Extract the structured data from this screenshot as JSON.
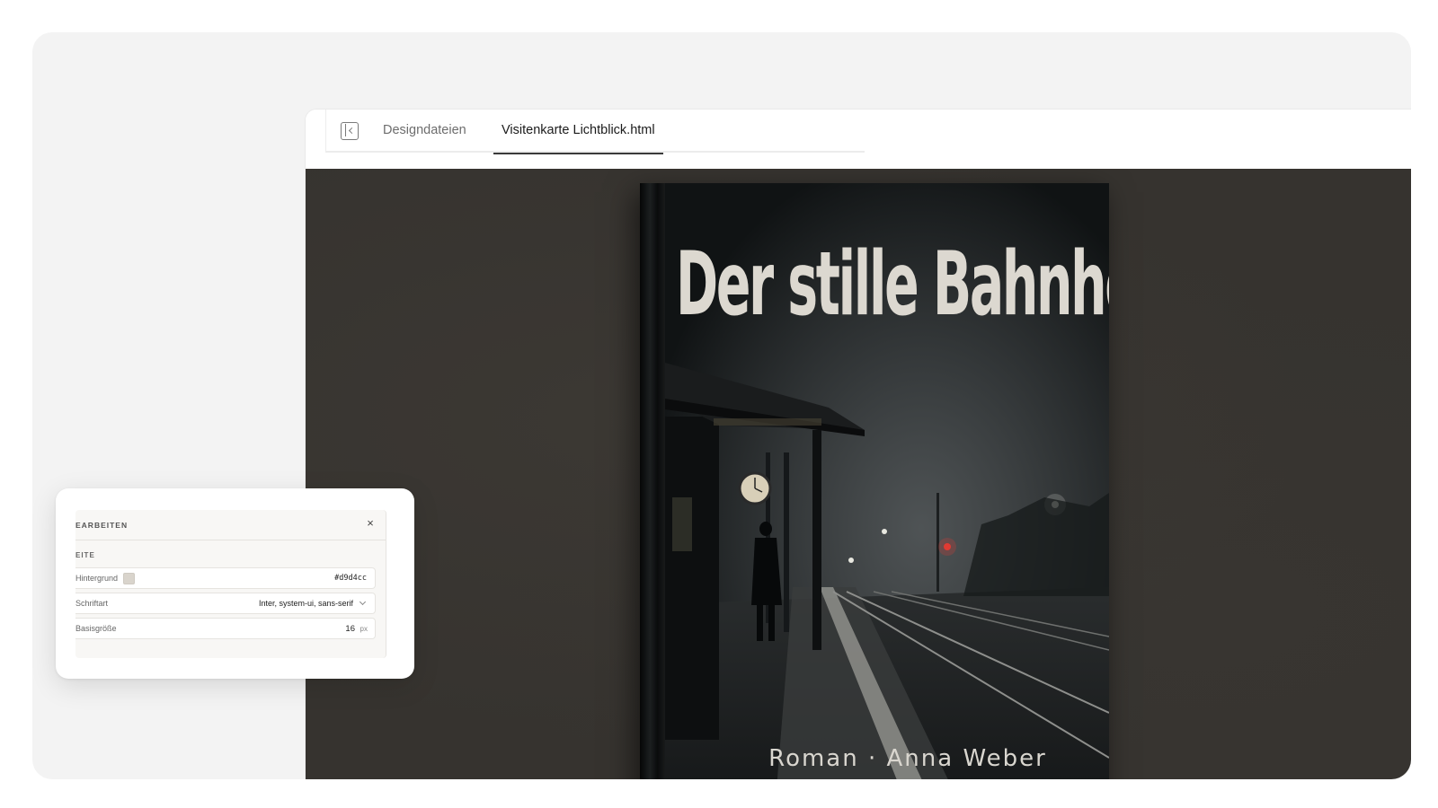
{
  "tabs": {
    "items": [
      {
        "label": "Designdateien",
        "active": false
      },
      {
        "label": "Visitenkarte Lichtblick.html",
        "active": true
      }
    ]
  },
  "icons": {
    "sidebar_toggle": "sidebar-toggle-icon",
    "close": "close-icon",
    "chevron": "chevron-down-icon"
  },
  "book": {
    "title": "Der stille Bahnhof",
    "subtitle": "Roman · Anna Weber"
  },
  "panel": {
    "title": "EARBEITEN",
    "close_glyph": "×",
    "section": "EITE",
    "rows": {
      "background": {
        "label": "Hintergrund",
        "value": "#d9d4cc",
        "swatch": "#d9d4cc"
      },
      "font": {
        "label": "Schriftart",
        "value": "Inter, system-ui, sans-serif"
      },
      "base_size": {
        "label": "Basisgröße",
        "value": "16",
        "unit": "px"
      }
    }
  },
  "colors": {
    "stage_bg": "#f3f3f3",
    "canvas_bg": "#36332f",
    "title_color": "#dcd8d0"
  }
}
